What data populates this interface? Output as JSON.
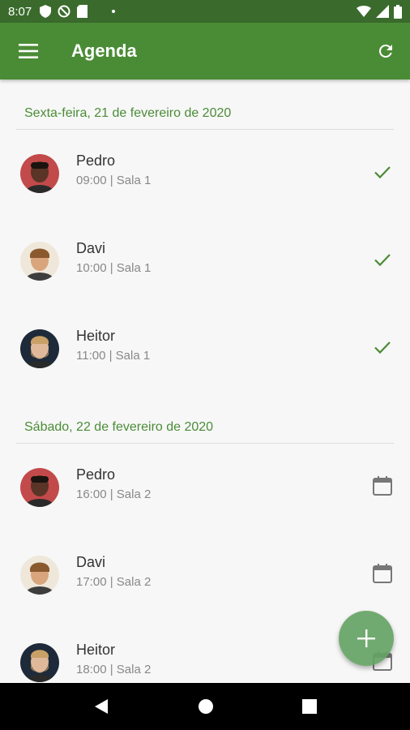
{
  "status_bar": {
    "time": "8:07",
    "left_icons": [
      "shield-icon",
      "no-disturb-icon",
      "sd-card-icon",
      "dot-icon"
    ],
    "right_icons": [
      "wifi-icon",
      "signal-icon",
      "battery-icon"
    ]
  },
  "app_bar": {
    "title": "Agenda",
    "menu_icon": "menu-icon",
    "refresh_icon": "refresh-icon",
    "background": "#4a8c36"
  },
  "sections": [
    {
      "date": "Sexta-feira, 21 de fevereiro de 2020",
      "items": [
        {
          "name": "Pedro",
          "detail": "09:00 | Sala 1",
          "status_icon": "check-icon"
        },
        {
          "name": "Davi",
          "detail": "10:00 | Sala 1",
          "status_icon": "check-icon"
        },
        {
          "name": "Heitor",
          "detail": "11:00 | Sala 1",
          "status_icon": "check-icon"
        }
      ]
    },
    {
      "date": "Sábado, 22 de fevereiro de 2020",
      "items": [
        {
          "name": "Pedro",
          "detail": "16:00 | Sala 2",
          "status_icon": "calendar-icon"
        },
        {
          "name": "Davi",
          "detail": "17:00 | Sala 2",
          "status_icon": "calendar-icon"
        },
        {
          "name": "Heitor",
          "detail": "18:00 | Sala 2",
          "status_icon": "calendar-icon"
        }
      ]
    }
  ],
  "fab": {
    "icon": "add-icon"
  },
  "nav_bar": {
    "icons": [
      "back-icon",
      "home-icon",
      "recents-icon"
    ]
  },
  "colors": {
    "accent": "#4a8c36",
    "status_bar": "#3a6b2c",
    "check": "#4a8c36"
  }
}
